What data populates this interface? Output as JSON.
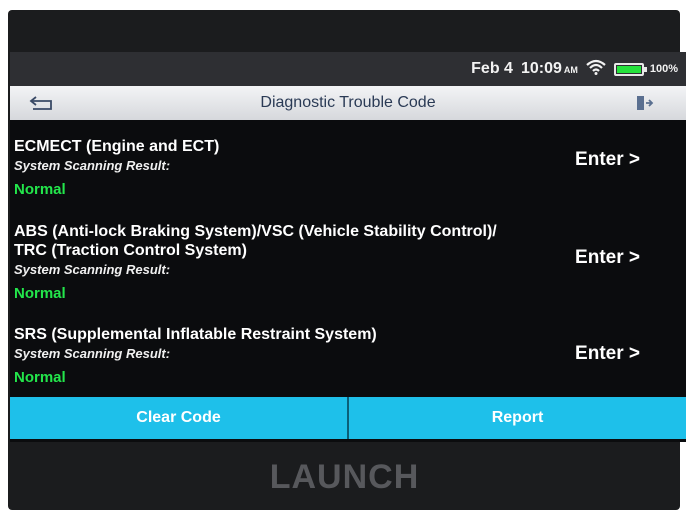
{
  "status_bar": {
    "date": "Feb 4",
    "time": "10:09",
    "ampm": "AM",
    "battery": "100%"
  },
  "header": {
    "title": "Diagnostic Trouble Code"
  },
  "systems": [
    {
      "title": "ECMECT (Engine and ECT)",
      "subtitle": "System Scanning Result:",
      "status": "Normal",
      "action": "Enter >"
    },
    {
      "title": "ABS (Anti-lock Braking System)/VSC (Vehicle Stability Control)/ TRC (Traction Control System)",
      "subtitle": "System Scanning Result:",
      "status": "Normal",
      "action": "Enter >"
    },
    {
      "title": "SRS (Supplemental Inflatable Restraint System)",
      "subtitle": "System Scanning Result:",
      "status": "Normal",
      "action": "Enter >"
    }
  ],
  "footer": {
    "clear_code": "Clear Code",
    "report": "Report"
  },
  "brand": "LAUNCH",
  "colors": {
    "accent": "#1ec0ea",
    "normal_status": "#23e64b",
    "battery": "#25e23c"
  },
  "icons": [
    "back-icon",
    "exit-icon",
    "wifi-icon",
    "battery-icon"
  ]
}
